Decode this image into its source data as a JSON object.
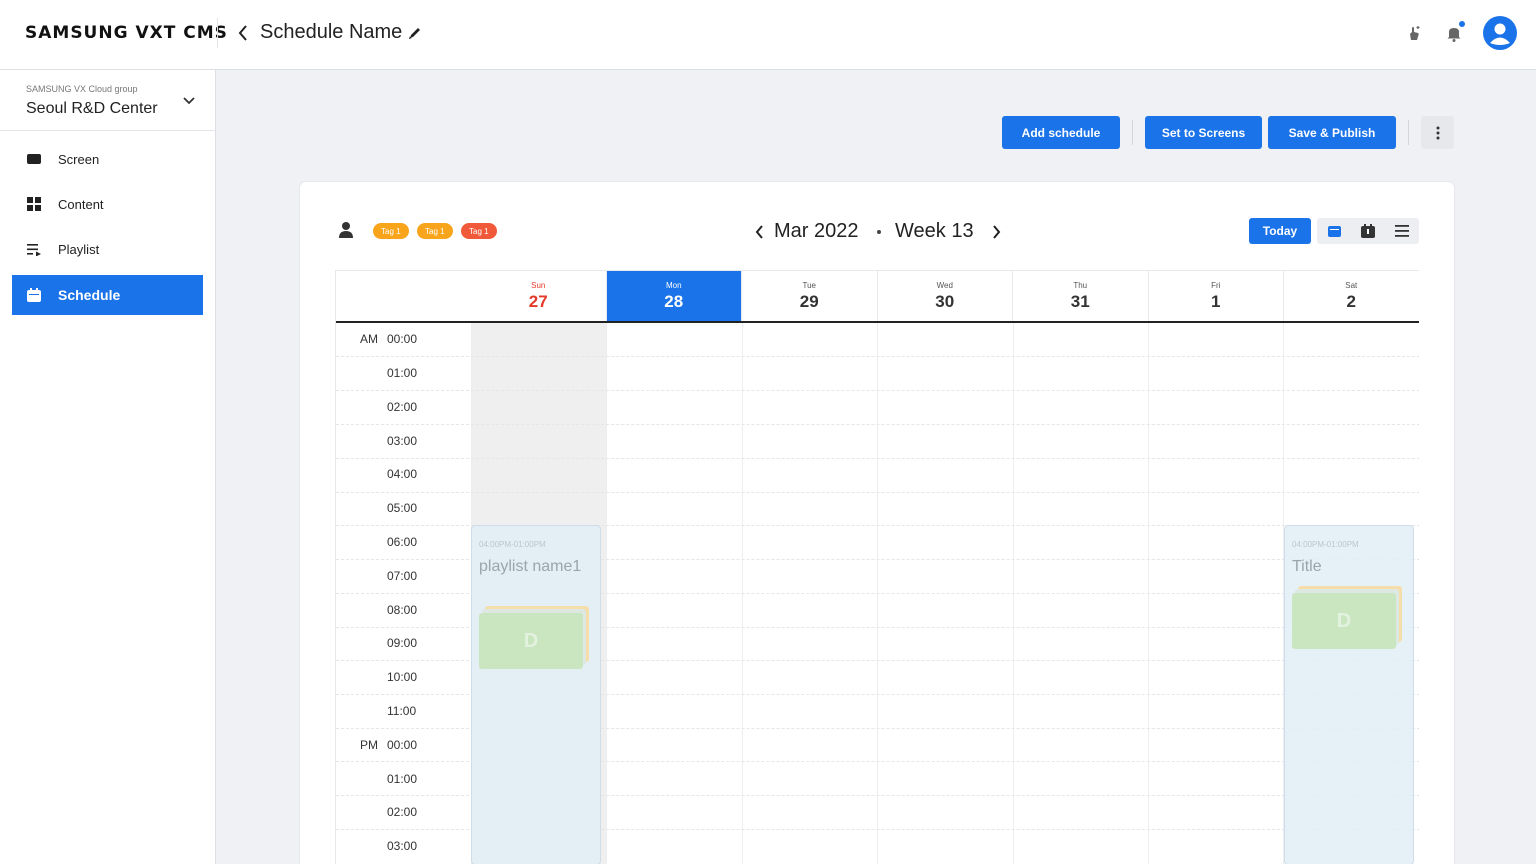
{
  "header": {
    "logo": "SAMSUNG VXT CMS",
    "schedule_name": "Schedule Name"
  },
  "sidebar": {
    "group_label": "SAMSUNG VX Cloud group",
    "group_name": "Seoul R&D Center",
    "items": [
      {
        "label": "Screen",
        "icon": "screen-icon",
        "active": false
      },
      {
        "label": "Content",
        "icon": "content-grid-icon",
        "active": false
      },
      {
        "label": "Playlist",
        "icon": "playlist-icon",
        "active": false
      },
      {
        "label": "Schedule",
        "icon": "calendar-icon",
        "active": true
      }
    ]
  },
  "actions": {
    "add_schedule": "Add schedule",
    "set_to_screens": "Set to Screens",
    "save_publish": "Save & Publish"
  },
  "calendar": {
    "tags": [
      {
        "label": "Tag 1",
        "color": "#f8a51b"
      },
      {
        "label": "Tag 1",
        "color": "#f8a51b"
      },
      {
        "label": "Tag 1",
        "color": "#f05a3a"
      }
    ],
    "month": "Mar 2022",
    "week": "Week 13",
    "today_label": "Today",
    "days": [
      {
        "name": "Sun",
        "num": "27"
      },
      {
        "name": "Mon",
        "num": "28"
      },
      {
        "name": "Tue",
        "num": "29"
      },
      {
        "name": "Wed",
        "num": "30"
      },
      {
        "name": "Thu",
        "num": "31"
      },
      {
        "name": "Fri",
        "num": "1"
      },
      {
        "name": "Sat",
        "num": "2"
      }
    ],
    "selected_day": "Mon",
    "times": [
      {
        "ampm": "AM",
        "t": "00:00"
      },
      {
        "ampm": "",
        "t": "01:00"
      },
      {
        "ampm": "",
        "t": "02:00"
      },
      {
        "ampm": "",
        "t": "03:00"
      },
      {
        "ampm": "",
        "t": "04:00"
      },
      {
        "ampm": "",
        "t": "05:00"
      },
      {
        "ampm": "",
        "t": "06:00"
      },
      {
        "ampm": "",
        "t": "07:00"
      },
      {
        "ampm": "",
        "t": "08:00"
      },
      {
        "ampm": "",
        "t": "09:00"
      },
      {
        "ampm": "",
        "t": "10:00"
      },
      {
        "ampm": "",
        "t": "11:00"
      },
      {
        "ampm": "PM",
        "t": "00:00"
      },
      {
        "ampm": "",
        "t": "01:00"
      },
      {
        "ampm": "",
        "t": "02:00"
      },
      {
        "ampm": "",
        "t": "03:00"
      }
    ],
    "events": [
      {
        "day": "Sun",
        "time_range": "04:00PM-01:00PM",
        "title": "playlist name1",
        "thumb_letter": "D"
      },
      {
        "day": "Sat",
        "time_range": "04:00PM-01:00PM",
        "title": "Title",
        "thumb_letter": "D"
      }
    ]
  },
  "colors": {
    "accent": "#1a73e8",
    "sunday": "#e5392a"
  }
}
